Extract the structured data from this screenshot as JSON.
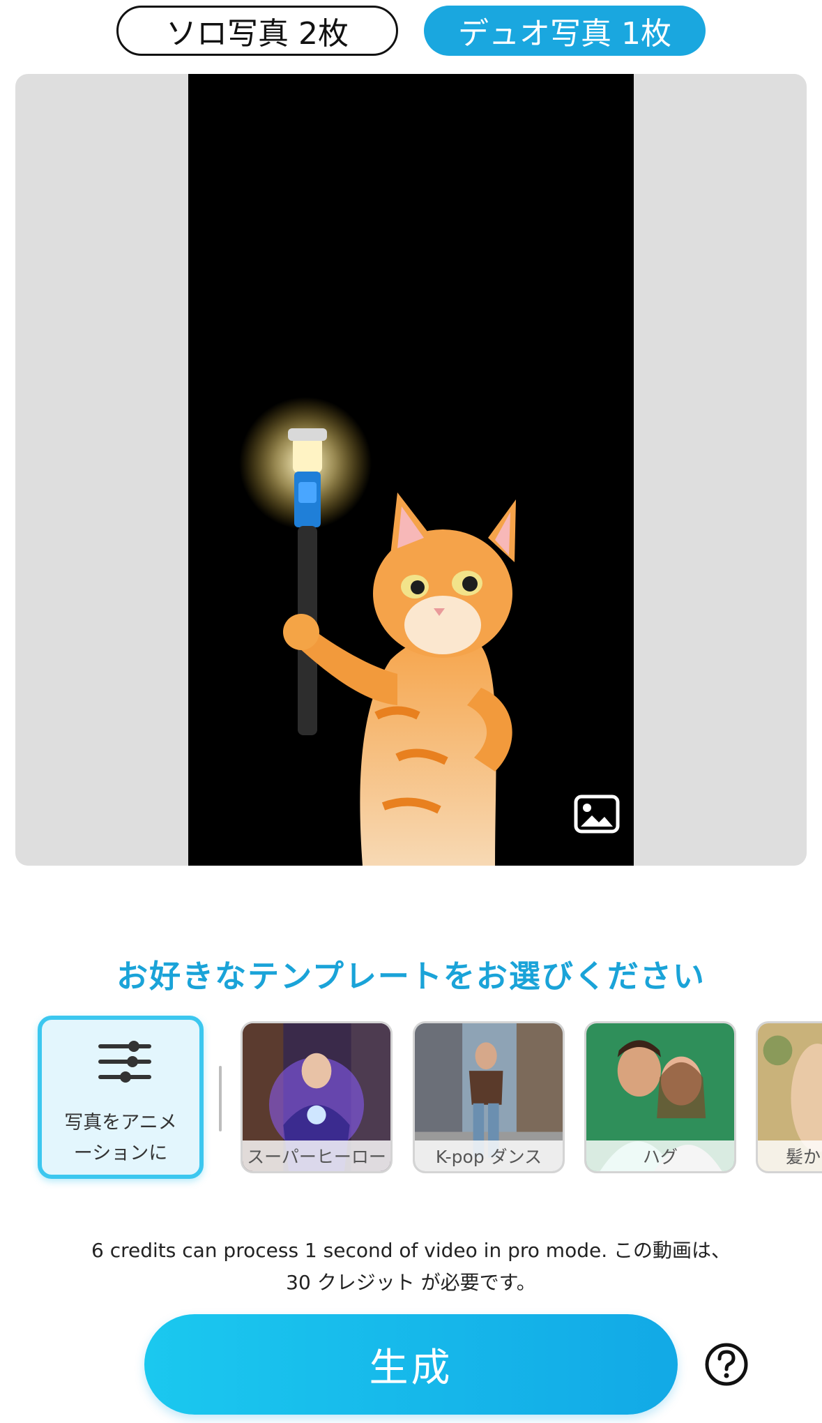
{
  "tabs": {
    "solo_label": "ソロ写真 2枚",
    "duo_label": "デュオ写真 1枚",
    "active": "duo"
  },
  "preview": {
    "image_subject": "orange cat holding a glowing light stick on black background",
    "gallery_icon": "image-gallery-icon"
  },
  "heading": "お好きなテンプレートをお選びください",
  "templates": {
    "custom_label": "写真をアニメーションに",
    "custom_label_line1": "写真をアニメ",
    "custom_label_line2": "ーションに",
    "custom_icon": "sliders-icon",
    "items": [
      {
        "label": "スーパーヒーロー"
      },
      {
        "label": "K-pop ダンス"
      },
      {
        "label": "ハグ"
      },
      {
        "label": "髪か"
      }
    ]
  },
  "credits_line1": "6 credits can process 1 second of video in pro mode. この動画は、",
  "credits_line2": "30 クレジット が必要です。",
  "generate_label": "生成",
  "help_icon": "question-circle-icon",
  "colors": {
    "accent": "#1aa7df",
    "heading": "#1aa3d8",
    "button_start": "#1bc8ef",
    "button_end": "#12a9e6"
  }
}
